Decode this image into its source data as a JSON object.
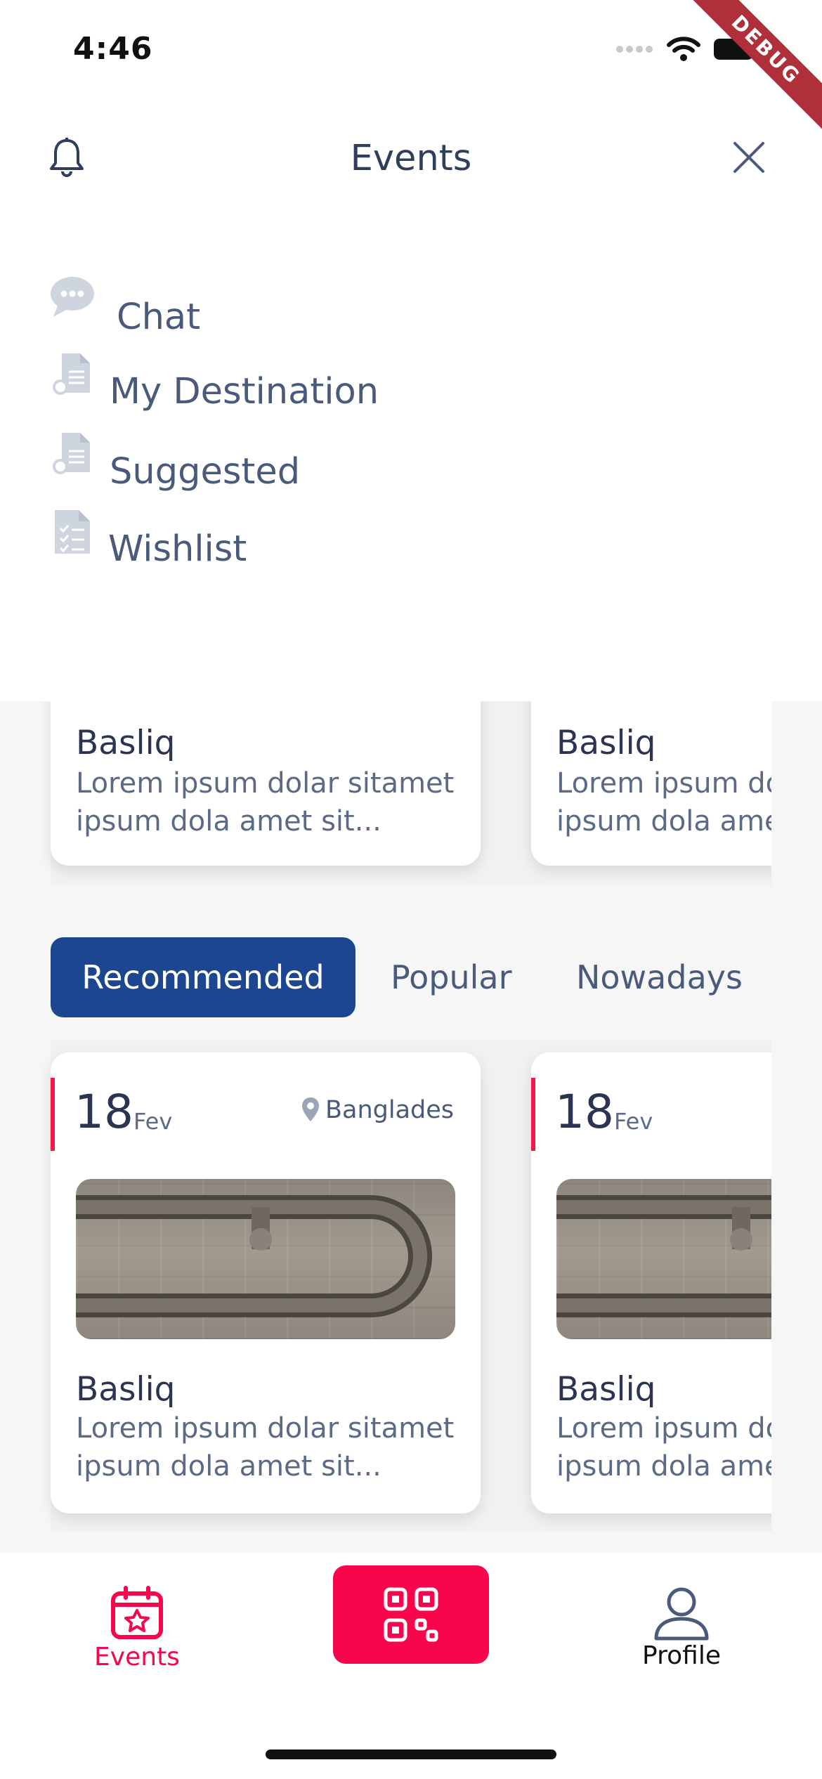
{
  "status_bar": {
    "time": "4:46",
    "debug_label": "DEBUG"
  },
  "header": {
    "title": "Events"
  },
  "menu": [
    {
      "label": "Chat",
      "icon": "chat-bubble-icon"
    },
    {
      "label": "My Destination",
      "icon": "document-icon"
    },
    {
      "label": "Suggested",
      "icon": "document-icon"
    },
    {
      "label": "Wishlist",
      "icon": "checklist-icon"
    }
  ],
  "top_cards": [
    {
      "title": "Basliq",
      "desc_line1": "Lorem ipsum dolar sitamet",
      "desc_line2": "ipsum dola amet sit..."
    },
    {
      "title": "Basliq",
      "desc_line1": "Lorem ipsum dolar sitamet",
      "desc_line2": "ipsum dola amet sit..."
    }
  ],
  "tabs": [
    {
      "label": "Recommended",
      "active": true
    },
    {
      "label": "Popular",
      "active": false
    },
    {
      "label": "Nowadays",
      "active": false
    }
  ],
  "event_cards": [
    {
      "day": "18",
      "month": "Fev",
      "location": "Banglades",
      "title": "Basliq",
      "desc_line1": "Lorem ipsum dolar sitamet",
      "desc_line2": "ipsum dola amet sit..."
    },
    {
      "day": "18",
      "month": "Fev",
      "location": "",
      "title": "Basliq",
      "desc_line1": "Lorem ipsum dolar sitamet",
      "desc_line2": "ipsum dola amet sit..."
    }
  ],
  "bottom_nav": {
    "events_label": "Events",
    "profile_label": "Profile",
    "scan_icon": "qr-scan-icon"
  },
  "colors": {
    "brand_blue": "#1d4690",
    "accent_pink": "#f7064b",
    "text_dark": "#2b3450",
    "text_muted": "#5b6a86"
  }
}
